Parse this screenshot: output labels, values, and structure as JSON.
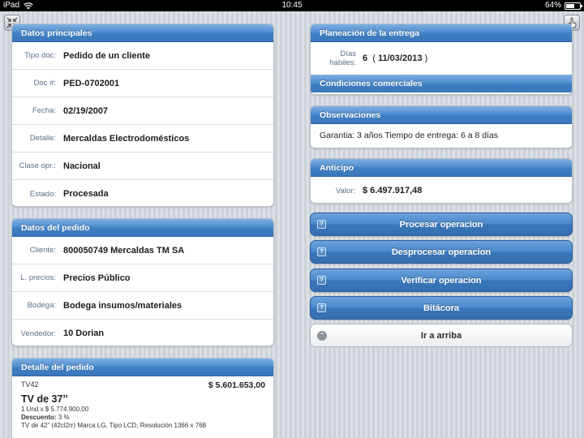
{
  "statusbar": {
    "device": "iPad",
    "time": "10:45",
    "battery": "64%",
    "battery_level": 0.64
  },
  "datos_principales": {
    "title": "Datos principales",
    "rows": [
      {
        "label": "Tipo doc:",
        "value": "Pedido de un cliente"
      },
      {
        "label": "Doc #:",
        "value": "PED-0702001"
      },
      {
        "label": "Fecha:",
        "value": "02/19/2007"
      },
      {
        "label": "Detalle:",
        "value": "Mercaldas Electrodomésticos"
      },
      {
        "label": "Clase opr.:",
        "value": "Nacional"
      },
      {
        "label": "Estado:",
        "value": "Procesada"
      }
    ]
  },
  "datos_pedido": {
    "title": "Datos del pedido",
    "rows": [
      {
        "label": "Cliente:",
        "value": "800050749 Mercaldas TM SA"
      },
      {
        "label": "L. precios:",
        "value": "Precios Público"
      },
      {
        "label": "Bodega:",
        "value": "Bodega insumos/materiales"
      },
      {
        "label": "Vendedor:",
        "value": "10 Dorian"
      }
    ]
  },
  "detalle_pedido": {
    "title": "Detalle del pedido",
    "code": "TV42",
    "amount": "$ 5.601.653,00",
    "product": "TV de 37’’",
    "qty_line": "1 Und x $ 5.774.900,00",
    "discount_label": "Descuento:",
    "discount_value": "3 %",
    "description": "TV de 42” (42cl2rr) Marca LG, Tipo LCD, Resolución 1366 x 768"
  },
  "planeacion": {
    "title": "Planeación de la entrega",
    "label_line1": "Días",
    "label_line2": "habiles:",
    "days": "6",
    "paren_open": "(",
    "date": "11/03/2013",
    "paren_close": ")"
  },
  "condiciones": {
    "title": "Condiciones comerciales"
  },
  "observaciones": {
    "title": "Observaciones",
    "text": "Garantia: 3 años Tiempo de entrega: 6 a 8 días"
  },
  "anticipo": {
    "title": "Anticipo",
    "label": "Valor:",
    "value": "$ 6.497.917,48"
  },
  "actions": {
    "procesar": "Procesar operacion",
    "desprocesar": "Desprocesar operacion",
    "verificar": "Verificar operacion",
    "bitacora": "Bitácora",
    "arriba": "Ir a arriba",
    "icon_glyph": "?",
    "up_glyph": "⌃"
  },
  "colors": {
    "header_blue": "#4d8ccf",
    "button_blue": "#4a88cb",
    "label_gray_blue": "#5b6f88"
  }
}
